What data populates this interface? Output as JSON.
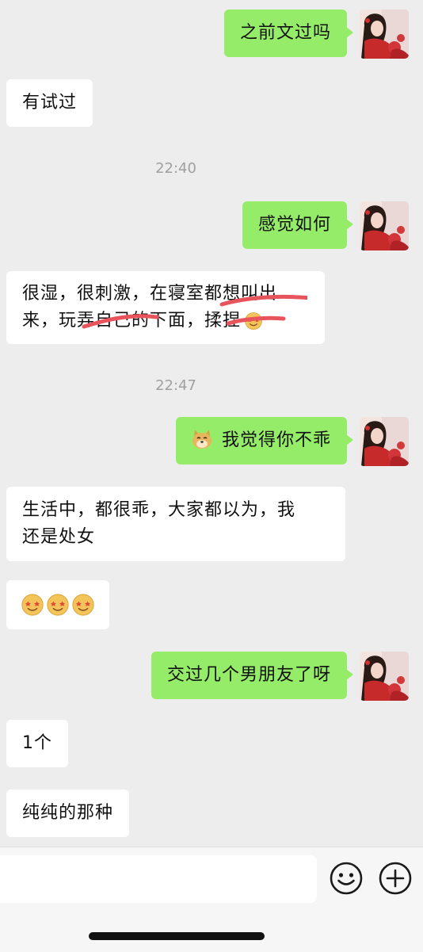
{
  "messages": [
    {
      "side": "right",
      "text": "之前文过吗"
    },
    {
      "side": "left",
      "text": "有试过"
    },
    {
      "side": "time",
      "text": "22:40"
    },
    {
      "side": "right",
      "text": "感觉如何"
    },
    {
      "side": "left",
      "line1": "很湿，很刺激，在寝室都想叫出",
      "line2": "来，玩弄自己的下面，揉捏"
    },
    {
      "side": "time",
      "text": "22:47"
    },
    {
      "side": "right",
      "text": "我觉得你不乖",
      "emoji": "doge-icon"
    },
    {
      "side": "left",
      "line1": "生活中，都很乖，大家都以为，我",
      "line2": "还是处女"
    },
    {
      "side": "left",
      "emoji": "star-struck-emoji x3"
    },
    {
      "side": "right",
      "text": "交过几个男朋友了呀"
    },
    {
      "side": "left",
      "text": "1个"
    },
    {
      "side": "left",
      "text": "纯纯的那种"
    }
  ],
  "input_bar": {
    "placeholder": "",
    "icons": [
      "smiley-icon",
      "plus-icon"
    ]
  },
  "colors": {
    "background": "#ededed",
    "bubble_self": "#95ec69",
    "bubble_other": "#ffffff",
    "timestamp": "#a0a0a0",
    "scribble": "#e8545c"
  }
}
